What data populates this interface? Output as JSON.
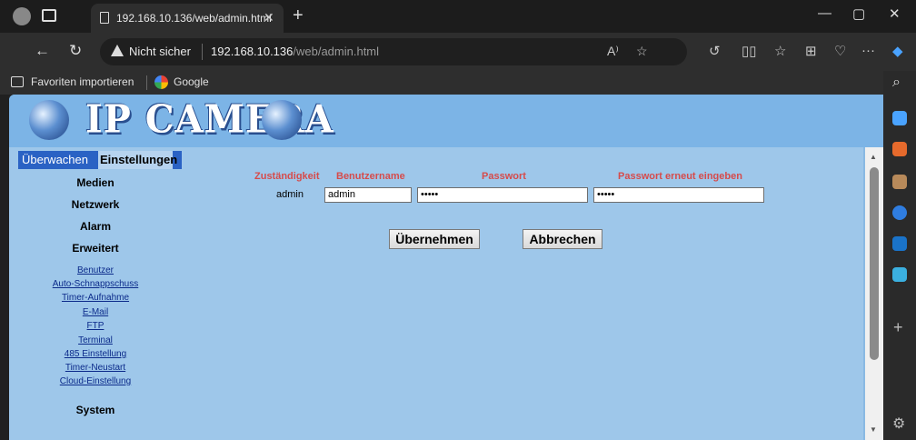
{
  "tab": {
    "title": "192.168.10.136/web/admin.html",
    "close": "✕",
    "new": "+"
  },
  "window": {
    "minimize": "—",
    "maximize": "▢",
    "close": "✕"
  },
  "address": {
    "security": "Nicht sicher",
    "host": "192.168.10.136",
    "path": "/web/admin.html"
  },
  "favorites": [
    {
      "label": "Favoriten importieren"
    },
    {
      "label": "Google"
    }
  ],
  "logo": {
    "text": "IP CAMERA"
  },
  "nav": {
    "top_left": "Überwachen",
    "top_right": "Einstellungen",
    "sections": [
      "Medien",
      "Netzwerk",
      "Alarm",
      "Erweitert"
    ],
    "links": [
      "Benutzer",
      "Auto-Schnappschuss",
      "Timer-Aufnahme",
      "E-Mail",
      "FTP",
      "Terminal",
      "485 Einstellung",
      "Timer-Neustart",
      "Cloud-Einstellung"
    ],
    "system": "System"
  },
  "form": {
    "headers": {
      "role": "Zuständigkeit",
      "username": "Benutzername",
      "password": "Passwort",
      "confirm": "Passwort erneut eingeben"
    },
    "row": {
      "role": "admin",
      "username": "admin",
      "password": "•••••",
      "confirm": "•••••"
    },
    "apply": "Übernehmen",
    "cancel": "Abbrechen"
  },
  "colors": {
    "page_bg": "#89b9e3",
    "header_red": "#d64b4b",
    "nav_active": "#2a62c4"
  }
}
